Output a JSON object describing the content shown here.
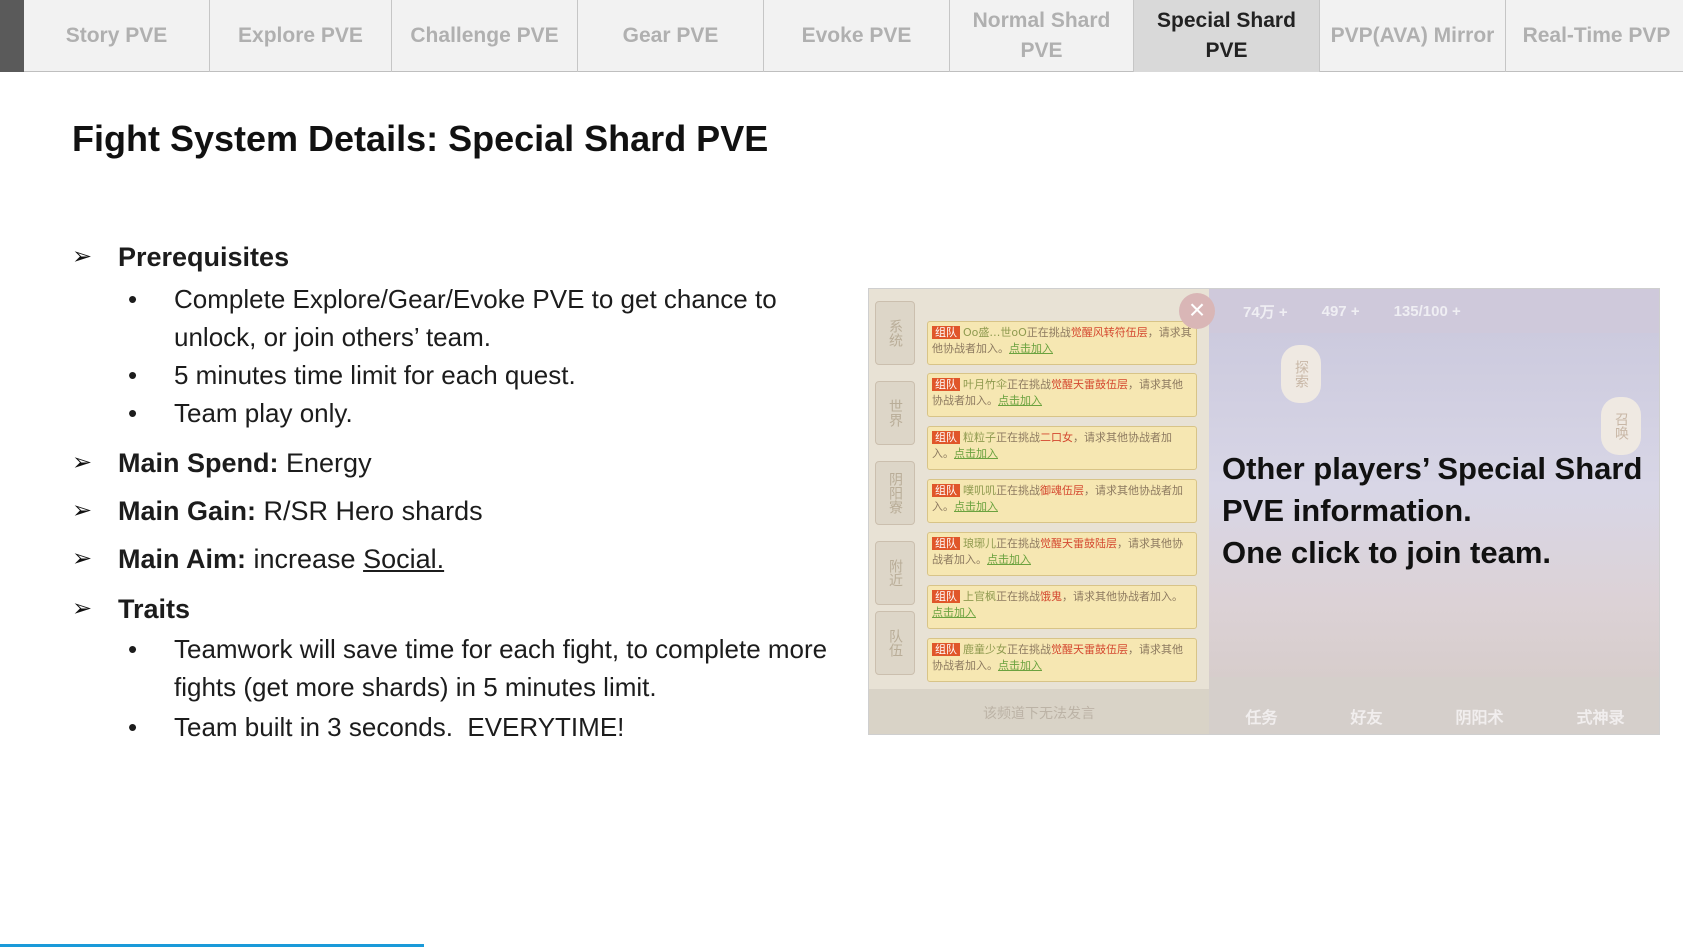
{
  "tabs": [
    {
      "label": "Story PVE"
    },
    {
      "label": "Explore PVE"
    },
    {
      "label": "Challenge PVE"
    },
    {
      "label": "Gear PVE"
    },
    {
      "label": "Evoke PVE"
    },
    {
      "label": "Normal Shard PVE"
    },
    {
      "label": "Special Shard PVE",
      "active": true
    },
    {
      "label": "PVP(AVA) Mirror"
    },
    {
      "label": "Real-Time PVP"
    }
  ],
  "slide": {
    "title": "Fight System Details: Special Shard PVE",
    "prerequisites": {
      "heading": "Prerequisites",
      "items": [
        "Complete Explore/Gear/Evoke PVE to get chance to unlock, or join others’ team.",
        "5 minutes time limit for each quest.",
        "Team play only."
      ]
    },
    "main_spend": {
      "label": "Main Spend:",
      "value": "Energy"
    },
    "main_gain": {
      "label": "Main Gain:",
      "value": "R/SR Hero shards"
    },
    "main_aim": {
      "label": "Main Aim:",
      "value_prefix": "increase ",
      "value_link": "Social."
    },
    "traits": {
      "heading": "Traits",
      "items": [
        "Teamwork will save time for each fight, to complete more fights (get more shards) in 5 minutes limit.",
        "Team built in 3 seconds.  EVERYTIME!"
      ]
    }
  },
  "screenshot": {
    "overlay_lines": [
      "Other players’ Special Shard",
      "PVE information.",
      "One click to join team."
    ],
    "side_tabs": [
      "系统",
      "世界",
      "阴阳寮",
      "附近",
      "队伍"
    ],
    "messages": [
      {
        "team": "组队",
        "user": "Oo盛…世oO",
        "pre": "正在挑战",
        "target": "觉醒风转符伍层",
        "post": "，请求其他协战者加入。",
        "join": "点击加入"
      },
      {
        "team": "组队",
        "user": "叶月竹伞",
        "pre": "正在挑战",
        "target": "觉醒天雷鼓伍层",
        "post": "，请求其他协战者加入。",
        "join": "点击加入"
      },
      {
        "team": "组队",
        "user": "粒粒子",
        "pre": "正在挑战",
        "target": "二口女",
        "post": "，请求其他协战者加入。",
        "join": "点击加入"
      },
      {
        "team": "组队",
        "user": "噗叽叽",
        "pre": "正在挑战",
        "target": "御魂伍层",
        "post": "，请求其他协战者加入。",
        "join": "点击加入"
      },
      {
        "team": "组队",
        "user": "琅琊儿",
        "pre": "正在挑战",
        "target": "觉醒天雷鼓陆层",
        "post": "，请求其他协战者加入。",
        "join": "点击加入"
      },
      {
        "team": "组队",
        "user": "上官枫",
        "pre": "正在挑战",
        "target": "饿鬼",
        "post": "，请求其他协战者加入。",
        "join": "点击加入"
      },
      {
        "team": "组队",
        "user": "鹿童少女",
        "pre": "正在挑战",
        "target": "觉醒天雷鼓伍层",
        "post": "，请求其他协战者加入。",
        "join": "点击加入"
      }
    ],
    "chat_footer": "该频道下无法发言",
    "close_glyph": "×",
    "hud": {
      "gold": "74万 +",
      "jade": "497 +",
      "stamina": "135/100 +"
    },
    "lanterns": [
      "探索",
      "召唤"
    ],
    "bottom_menu": [
      "任务",
      "好友",
      "阴阳术",
      "式神录"
    ]
  }
}
